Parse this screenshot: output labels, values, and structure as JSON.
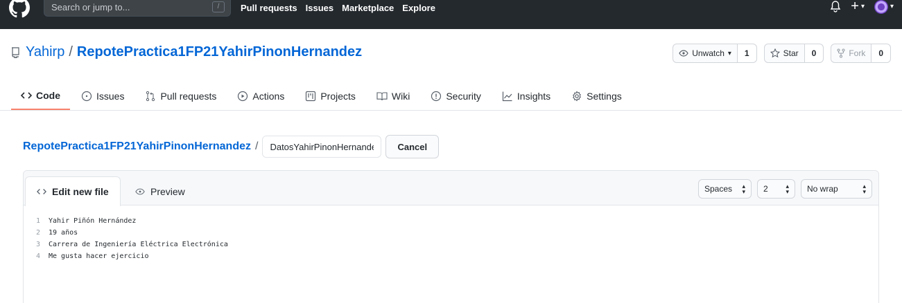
{
  "header": {
    "search_placeholder": "Search or jump to...",
    "search_shortcut": "/",
    "nav": [
      "Pull requests",
      "Issues",
      "Marketplace",
      "Explore"
    ],
    "plus": "+",
    "caret": "▾"
  },
  "repo": {
    "owner": "Yahirp",
    "separator": "/",
    "name": "RepotePractica1FP21YahirPinonHernandez",
    "watch_label": "Unwatch",
    "watch_count": "1",
    "star_label": "Star",
    "star_count": "0",
    "fork_label": "Fork",
    "fork_count": "0"
  },
  "tabs": [
    {
      "label": "Code",
      "icon": "code-icon"
    },
    {
      "label": "Issues",
      "icon": "issue-icon"
    },
    {
      "label": "Pull requests",
      "icon": "pull-request-icon"
    },
    {
      "label": "Actions",
      "icon": "play-icon"
    },
    {
      "label": "Projects",
      "icon": "project-icon"
    },
    {
      "label": "Wiki",
      "icon": "book-icon"
    },
    {
      "label": "Security",
      "icon": "shield-icon"
    },
    {
      "label": "Insights",
      "icon": "graph-icon"
    },
    {
      "label": "Settings",
      "icon": "gear-icon"
    }
  ],
  "editor_path": {
    "repo_link": "RepotePractica1FP21YahirPinonHernandez",
    "slash": "/",
    "filename_value": "DatosYahirPinonHernandez",
    "cancel_label": "Cancel"
  },
  "editor": {
    "edit_tab": "Edit new file",
    "preview_tab": "Preview",
    "indent_mode": "Spaces",
    "indent_size": "2",
    "wrap_mode": "No wrap",
    "lines": [
      {
        "num": "1",
        "text": "Yahir Piñón Hernández"
      },
      {
        "num": "2",
        "text": "19 años"
      },
      {
        "num": "3",
        "text": "Carrera de Ingeniería Eléctrica Electrónica"
      },
      {
        "num": "4",
        "text": "Me gusta hacer ejercicio"
      }
    ]
  },
  "colors": {
    "header_bg": "#24292e",
    "link": "#0366d6",
    "active_tab_underline": "#f9826c"
  }
}
